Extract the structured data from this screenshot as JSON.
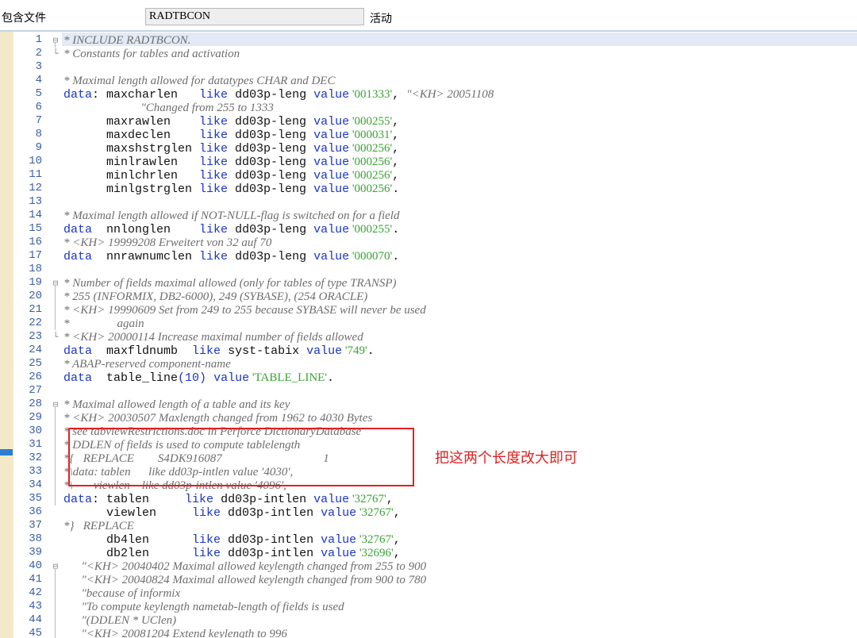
{
  "header": {
    "include_label": "包含文件",
    "include_value": "RADTBCON",
    "status": "活动"
  },
  "annotation": "把这两个长度改大即可",
  "lines": [
    {
      "n": "1",
      "fold": "⊟",
      "segs": [
        [
          "c",
          "* INCLUDE RADTBCON."
        ]
      ]
    },
    {
      "n": "2",
      "fold": "└",
      "segs": [
        [
          "c",
          "* Constants for tables and activation"
        ]
      ]
    },
    {
      "n": "3",
      "segs": []
    },
    {
      "n": "4",
      "segs": [
        [
          "c",
          "* Maximal length allowed for datatypes CHAR and DEC"
        ]
      ]
    },
    {
      "n": "5",
      "segs": [
        [
          "k",
          "data"
        ],
        [
          "t",
          ": maxcharlen   "
        ],
        [
          "k",
          "like"
        ],
        [
          "t",
          " dd03p-leng "
        ],
        [
          "k",
          "value"
        ],
        [
          "s",
          " '001333'"
        ],
        [
          "t",
          ", "
        ],
        [
          "c",
          "\"<KH> 20051108"
        ]
      ]
    },
    {
      "n": "6",
      "segs": [
        [
          "c",
          "                          \"Changed from 255 to 1333"
        ]
      ]
    },
    {
      "n": "7",
      "segs": [
        [
          "t",
          "      maxrawlen    "
        ],
        [
          "k",
          "like"
        ],
        [
          "t",
          " dd03p-leng "
        ],
        [
          "k",
          "value"
        ],
        [
          "s",
          " '000255'"
        ],
        [
          "t",
          ","
        ]
      ]
    },
    {
      "n": "8",
      "segs": [
        [
          "t",
          "      maxdeclen    "
        ],
        [
          "k",
          "like"
        ],
        [
          "t",
          " dd03p-leng "
        ],
        [
          "k",
          "value"
        ],
        [
          "s",
          " '000031'"
        ],
        [
          "t",
          ","
        ]
      ]
    },
    {
      "n": "9",
      "segs": [
        [
          "t",
          "      maxshstrglen "
        ],
        [
          "k",
          "like"
        ],
        [
          "t",
          " dd03p-leng "
        ],
        [
          "k",
          "value"
        ],
        [
          "s",
          " '000256'"
        ],
        [
          "t",
          ","
        ]
      ]
    },
    {
      "n": "10",
      "segs": [
        [
          "t",
          "      minlrawlen   "
        ],
        [
          "k",
          "like"
        ],
        [
          "t",
          " dd03p-leng "
        ],
        [
          "k",
          "value"
        ],
        [
          "s",
          " '000256'"
        ],
        [
          "t",
          ","
        ]
      ]
    },
    {
      "n": "11",
      "segs": [
        [
          "t",
          "      minlchrlen   "
        ],
        [
          "k",
          "like"
        ],
        [
          "t",
          " dd03p-leng "
        ],
        [
          "k",
          "value"
        ],
        [
          "s",
          " '000256'"
        ],
        [
          "t",
          ","
        ]
      ]
    },
    {
      "n": "12",
      "segs": [
        [
          "t",
          "      minlgstrglen "
        ],
        [
          "k",
          "like"
        ],
        [
          "t",
          " dd03p-leng "
        ],
        [
          "k",
          "value"
        ],
        [
          "s",
          " '000256'"
        ],
        [
          "t",
          "."
        ]
      ]
    },
    {
      "n": "13",
      "segs": []
    },
    {
      "n": "14",
      "segs": [
        [
          "c",
          "* Maximal length allowed if NOT-NULL-flag is switched on for a field"
        ]
      ]
    },
    {
      "n": "15",
      "segs": [
        [
          "k",
          "data"
        ],
        [
          "t",
          "  nnlonglen    "
        ],
        [
          "k",
          "like"
        ],
        [
          "t",
          " dd03p-leng "
        ],
        [
          "k",
          "value"
        ],
        [
          "s",
          " '000255'"
        ],
        [
          "t",
          "."
        ]
      ]
    },
    {
      "n": "16",
      "segs": [
        [
          "c",
          "* <KH> 19999208 Erweitert von 32 auf 70"
        ]
      ]
    },
    {
      "n": "17",
      "segs": [
        [
          "k",
          "data"
        ],
        [
          "t",
          "  nnrawnumclen "
        ],
        [
          "k",
          "like"
        ],
        [
          "t",
          " dd03p-leng "
        ],
        [
          "k",
          "value"
        ],
        [
          "s",
          " '000070'"
        ],
        [
          "t",
          "."
        ]
      ]
    },
    {
      "n": "18",
      "segs": []
    },
    {
      "n": "19",
      "fold": "⊟",
      "segs": [
        [
          "c",
          "* Number of fields maximal allowed (only for tables of type TRANSP)"
        ]
      ]
    },
    {
      "n": "20",
      "segs": [
        [
          "c",
          "* 255 (INFORMIX, DB2-6000), 249 (SYBASE), (254 ORACLE)"
        ]
      ]
    },
    {
      "n": "21",
      "segs": [
        [
          "c",
          "* <KH> 19990609 Set from 249 to 255 because SYBASE will never be used"
        ]
      ]
    },
    {
      "n": "22",
      "segs": [
        [
          "c",
          "*                again"
        ]
      ]
    },
    {
      "n": "23",
      "fold": "└",
      "segs": [
        [
          "c",
          "* <KH> 20000114 Increase maximal number of fields allowed"
        ]
      ]
    },
    {
      "n": "24",
      "segs": [
        [
          "k",
          "data"
        ],
        [
          "t",
          "  maxfldnumb  "
        ],
        [
          "k",
          "like"
        ],
        [
          "t",
          " syst-tabix "
        ],
        [
          "k",
          "value"
        ],
        [
          "s",
          " '749'"
        ],
        [
          "t",
          "."
        ]
      ]
    },
    {
      "n": "25",
      "segs": [
        [
          "c",
          "* ABAP-reserved component-name"
        ]
      ]
    },
    {
      "n": "26",
      "segs": [
        [
          "k",
          "data"
        ],
        [
          "t",
          "  table_line"
        ],
        [
          "k",
          "(10)"
        ],
        [
          "t",
          " "
        ],
        [
          "k",
          "value"
        ],
        [
          "s",
          " 'TABLE_LINE'"
        ],
        [
          "t",
          "."
        ]
      ]
    },
    {
      "n": "27",
      "segs": []
    },
    {
      "n": "28",
      "fold": "⊟",
      "segs": [
        [
          "c",
          "* Maximal allowed length of a table and its key"
        ]
      ]
    },
    {
      "n": "29",
      "segs": [
        [
          "c",
          "* <KH> 20030507 Maxlength changed from 1962 to 4030 Bytes"
        ]
      ]
    },
    {
      "n": "30",
      "segs": [
        [
          "c",
          "* see tabviewRestrictions.doc in Perforce DictionaryDatabase"
        ]
      ]
    },
    {
      "n": "31",
      "segs": [
        [
          "c",
          "* DDLEN of fields is used to compute tablelength"
        ]
      ]
    },
    {
      "n": "32",
      "segs": [
        [
          "c",
          "*{   REPLACE        S4DK916087                                  1"
        ]
      ]
    },
    {
      "n": "33",
      "segs": [
        [
          "c",
          "*\\data: tablen      like dd03p-intlen value '4030',"
        ]
      ]
    },
    {
      "n": "34",
      "segs": [
        [
          "c",
          "*\\       viewlen    like dd03p-intlen value '4096',"
        ]
      ]
    },
    {
      "n": "35",
      "segs": [
        [
          "k",
          "data"
        ],
        [
          "t",
          ": tablen     "
        ],
        [
          "k",
          "like"
        ],
        [
          "t",
          " dd03p-intlen "
        ],
        [
          "k",
          "value"
        ],
        [
          "s",
          " '32767'"
        ],
        [
          "t",
          ","
        ]
      ]
    },
    {
      "n": "36",
      "segs": [
        [
          "t",
          "      viewlen     "
        ],
        [
          "k",
          "like"
        ],
        [
          "t",
          " dd03p-intlen "
        ],
        [
          "k",
          "value"
        ],
        [
          "s",
          " '32767'"
        ],
        [
          "t",
          ","
        ]
      ]
    },
    {
      "n": "37",
      "segs": [
        [
          "c",
          "*}   REPLACE"
        ]
      ]
    },
    {
      "n": "38",
      "segs": [
        [
          "t",
          "      db4len      "
        ],
        [
          "k",
          "like"
        ],
        [
          "t",
          " dd03p-intlen "
        ],
        [
          "k",
          "value"
        ],
        [
          "s",
          " '32767'"
        ],
        [
          "t",
          ","
        ]
      ]
    },
    {
      "n": "39",
      "segs": [
        [
          "t",
          "      db2len      "
        ],
        [
          "k",
          "like"
        ],
        [
          "t",
          " dd03p-intlen "
        ],
        [
          "k",
          "value"
        ],
        [
          "s",
          " '32696'"
        ],
        [
          "t",
          ","
        ]
      ]
    },
    {
      "n": "40",
      "fold": "⊟",
      "segs": [
        [
          "c",
          "      \"<KH> 20040402 Maximal allowed keylength changed from 255 to 900"
        ]
      ]
    },
    {
      "n": "41",
      "segs": [
        [
          "c",
          "      \"<KH> 20040824 Maximal allowed keylength changed from 900 to 780"
        ]
      ]
    },
    {
      "n": "42",
      "segs": [
        [
          "c",
          "      \"because of informix"
        ]
      ]
    },
    {
      "n": "43",
      "segs": [
        [
          "c",
          "      \"To compute keylength nametab-length of fields is used"
        ]
      ]
    },
    {
      "n": "44",
      "segs": [
        [
          "c",
          "      \"(DDLEN * UClen)"
        ]
      ]
    },
    {
      "n": "45",
      "segs": [
        [
          "c",
          "      \"<KH> 20081204 Extend keylength to 996"
        ]
      ]
    }
  ]
}
